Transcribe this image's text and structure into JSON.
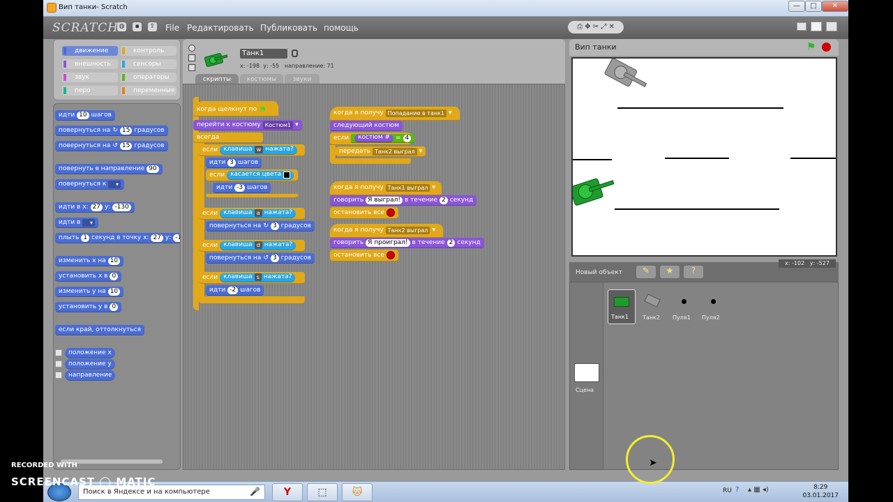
{
  "window": {
    "title": "Вип танки- Scratch",
    "controls": [
      "—",
      "□",
      "✕"
    ]
  },
  "menu": {
    "logo": "SCRATCH",
    "items": [
      "File",
      "Редактировать",
      "Публиковать",
      "помощь"
    ]
  },
  "categories": [
    {
      "label": "движение",
      "color": "#4a6cd4"
    },
    {
      "label": "контроль",
      "color": "#e1a91a"
    },
    {
      "label": "внешность",
      "color": "#8a55d7"
    },
    {
      "label": "сенсоры",
      "color": "#2ca5e2"
    },
    {
      "label": "звук",
      "color": "#cf4ad9"
    },
    {
      "label": "операторы",
      "color": "#5cb712"
    },
    {
      "label": "перо",
      "color": "#0fbd8c"
    },
    {
      "label": "переменные",
      "color": "#ee7d16"
    }
  ],
  "palette": {
    "move": {
      "a": "идти",
      "n": "10",
      "b": "шагов"
    },
    "turn_right": {
      "a": "повернуться на",
      "n": "15",
      "b": "градусов"
    },
    "turn_left": {
      "a": "повернуться на",
      "n": "15",
      "b": "градусов"
    },
    "point_dir": {
      "a": "повернуть в направление",
      "n": "90"
    },
    "point_to": {
      "a": "повернуться к"
    },
    "goto_xy": {
      "a": "идти в х:",
      "x": "27",
      "b": "у:",
      "y": "-130"
    },
    "goto": {
      "a": "идти в"
    },
    "glide": {
      "a": "плыть",
      "s": "1",
      "b": "секунд в точку х:",
      "x": "27",
      "c": "у:",
      "y": "-1"
    },
    "change_x": {
      "a": "изменить х на",
      "n": "10"
    },
    "set_x": {
      "a": "установить х в",
      "n": "0"
    },
    "change_y": {
      "a": "изменить у на",
      "n": "10"
    },
    "set_y": {
      "a": "установить у в",
      "n": "0"
    },
    "bounce": "если край, оттолкнуться",
    "reporters": [
      "положение х",
      "положение у",
      "направление"
    ]
  },
  "sprite": {
    "name": "Танк1",
    "coords": "х: -198  у: -55   направление: 71",
    "tabs": [
      "скрипты",
      "костюмы",
      "звуки"
    ]
  },
  "script1": {
    "hat": "когда щелкнут по",
    "costume": {
      "a": "перейти к костюму",
      "v": "Костюм1"
    },
    "forever": "всегда",
    "if1": {
      "a": "если",
      "b": "клавиша",
      "key": "w",
      "c": "нажата?"
    },
    "move1": {
      "a": "идти",
      "n": "3",
      "b": "шагов"
    },
    "if2": {
      "a": "если",
      "b": "касается цвета"
    },
    "move2": {
      "a": "идти",
      "n": "-3",
      "b": "шагов"
    },
    "if3": {
      "a": "если",
      "b": "клавиша",
      "key": "a",
      "c": "нажата?"
    },
    "turn1": {
      "a": "повернуться на",
      "n": "3",
      "b": "градусов"
    },
    "if4": {
      "a": "если",
      "b": "клавиша",
      "key": "d",
      "c": "нажата?"
    },
    "turn2": {
      "a": "повернуться на",
      "n": "3",
      "b": "градусов"
    },
    "if5": {
      "a": "если",
      "b": "клавиша",
      "key": "s",
      "c": "нажата?"
    },
    "move3": {
      "a": "идти",
      "n": "-2",
      "b": "шагов"
    }
  },
  "script2": {
    "hat": {
      "a": "когда я получу",
      "v": "Попадание в танк1"
    },
    "next": "следующий костюм",
    "if": {
      "a": "если",
      "b": "костюм #",
      "eq": "=",
      "n": "4"
    },
    "broadcast": {
      "a": "передать",
      "v": "Танк2 выграл"
    }
  },
  "script3": {
    "hat": {
      "a": "когда я получу",
      "v": "Танк1 выграл"
    },
    "say": {
      "a": "говорить",
      "v": "Я выграл!",
      "b": "в течение",
      "n": "2",
      "c": "секунд"
    },
    "stop": "остановить все"
  },
  "script4": {
    "hat": {
      "a": "когда я получу",
      "v": "Танк2 выграл"
    },
    "say": {
      "a": "говорить",
      "v": "Я проиграл!",
      "b": "в течение",
      "n": "2",
      "c": "секунд"
    },
    "stop": "остановить все"
  },
  "stage": {
    "title": "Вип танки",
    "mouse": "х: -102   у: -527"
  },
  "sprites_panel": {
    "new_object": "Новый объект",
    "sprites": [
      "Танк1",
      "Танк2",
      "Пуля1",
      "Пуля2"
    ],
    "stage_label": "Сцена"
  },
  "taskbar": {
    "search": "Поиск в Яндексе и на компьютере",
    "lang": "RU",
    "time": "8:29",
    "date": "03.01.2017"
  },
  "watermark": {
    "line1": "RECORDED WITH",
    "line2": "SCREENCAST ◯ MATIC"
  },
  "colors": {
    "motion": "#4a6cd4",
    "control": "#e1a91a",
    "looks": "#8a55d7",
    "sensing": "#2ca5e2",
    "operators": "#5cb712",
    "tank_green": "#1f9a2e",
    "tank_gray": "#8a8a8a"
  }
}
